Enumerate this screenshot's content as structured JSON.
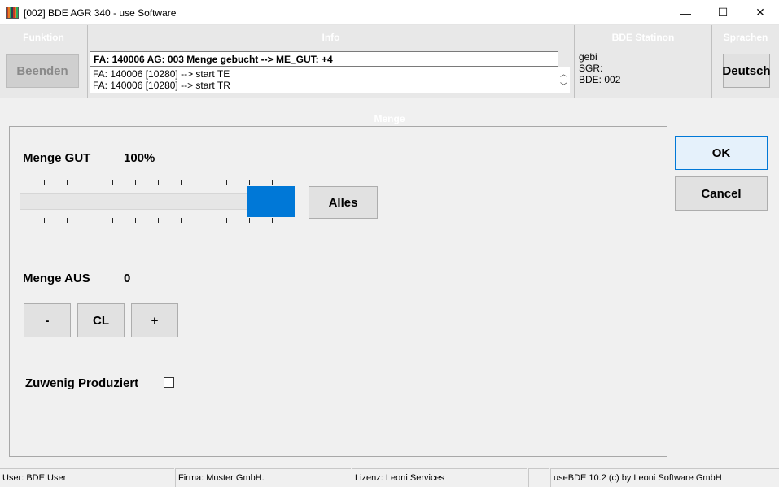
{
  "window": {
    "title": "[002] BDE AGR 340 - use Software",
    "minimize": "—",
    "maximize": "☐",
    "close": "✕"
  },
  "header": {
    "funktion": {
      "title": "Funktion",
      "button": "Beenden"
    },
    "info": {
      "title": "Info",
      "current": "FA: 140006 AG: 003 Menge gebucht --> ME_GUT: +4",
      "log": [
        "FA: 140006 [10280] --> start TE",
        "FA: 140006 [10280] --> start TR"
      ]
    },
    "station": {
      "title": "BDE Statinon",
      "lines": [
        "gebi",
        "SGR:",
        "BDE: 002"
      ]
    },
    "sprachen": {
      "title": "Sprachen",
      "button": "Deutsch"
    }
  },
  "menge": {
    "title": "Menge",
    "gut_label": "Menge GUT",
    "gut_value": "100%",
    "slider_level": 1.0,
    "alles_button": "Alles",
    "aus_label": "Menge AUS",
    "aus_value": "0",
    "minus_button": "-",
    "cl_button": "CL",
    "plus_button": "+",
    "zuwenig_label": "Zuwenig Produziert",
    "zuwenig_checked": false
  },
  "actions": {
    "ok": "OK",
    "cancel": "Cancel"
  },
  "status": {
    "user": "User: BDE User",
    "firma": "Firma: Muster GmbH.",
    "lizenz": "Lizenz: Leoni Services",
    "empty": "",
    "version": "useBDE 10.2 (c) by Leoni Software GmbH"
  },
  "colors": {
    "accent": "#0078d7",
    "header_bg": "#e8e8e8",
    "panel_bg": "#f0f0f0"
  }
}
